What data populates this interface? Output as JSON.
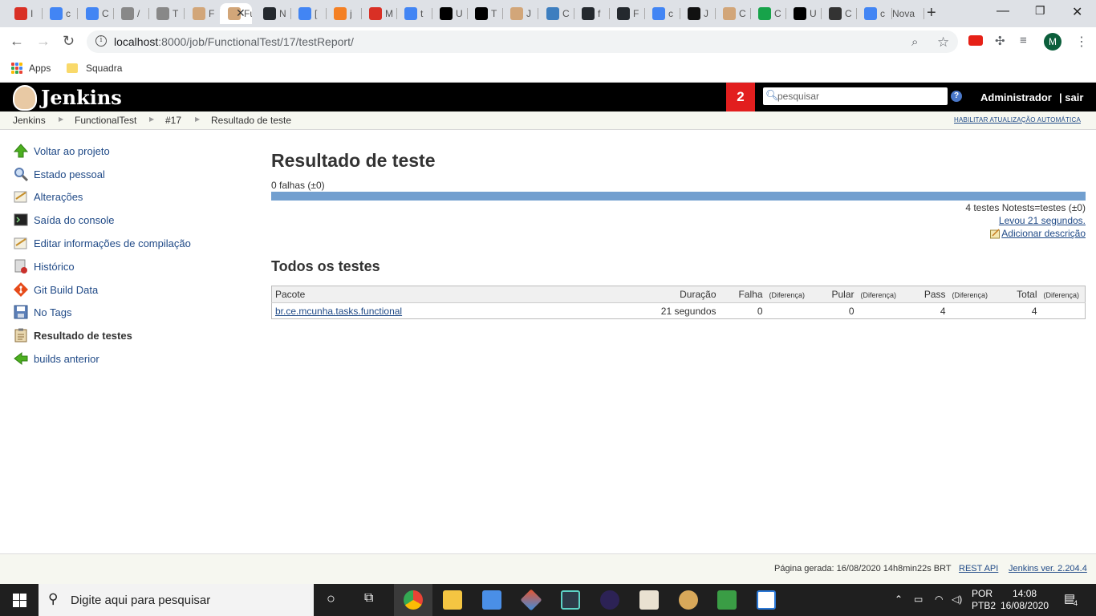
{
  "browser": {
    "tabs": [
      {
        "icon": "tab-favicon-u",
        "label": "I",
        "color": "#d93025"
      },
      {
        "icon": "google-icon",
        "label": "c",
        "color": "#4285f4"
      },
      {
        "icon": "google-translate-icon",
        "label": "C",
        "color": "#4285f4"
      },
      {
        "icon": "image-icon",
        "label": "/",
        "color": "#888888"
      },
      {
        "icon": "image-icon",
        "label": "T",
        "color": "#888888"
      },
      {
        "icon": "jenkins-icon",
        "label": "F",
        "color": "#d2a679"
      },
      {
        "icon": "jenkins-icon",
        "label": "Fu",
        "color": "#d2a679",
        "active": true
      },
      {
        "icon": "github-icon",
        "label": "N",
        "color": "#24292e"
      },
      {
        "icon": "google-icon",
        "label": "[",
        "color": "#4285f4"
      },
      {
        "icon": "stackoverflow-icon",
        "label": "j",
        "color": "#f48024"
      },
      {
        "icon": "pen-icon",
        "label": "M",
        "color": "#d93025"
      },
      {
        "icon": "google-icon",
        "label": "t",
        "color": "#4285f4"
      },
      {
        "icon": "medium-icon",
        "label": "U",
        "color": "#000000"
      },
      {
        "icon": "medium-icon",
        "label": "T",
        "color": "#000000"
      },
      {
        "icon": "jenkins-icon",
        "label": "J",
        "color": "#d2a679"
      },
      {
        "icon": "cube-icon",
        "label": "C",
        "color": "#3d7ebf"
      },
      {
        "icon": "github-icon",
        "label": "f",
        "color": "#24292e"
      },
      {
        "icon": "github-icon",
        "label": "F",
        "color": "#24292e"
      },
      {
        "icon": "google-icon",
        "label": "c",
        "color": "#4285f4"
      },
      {
        "icon": "circle-icon",
        "label": "J",
        "color": "#111111"
      },
      {
        "icon": "jenkins-icon",
        "label": "C",
        "color": "#d2a679"
      },
      {
        "icon": "gitkraken-icon",
        "label": "C",
        "color": "#17a34a"
      },
      {
        "icon": "medium-icon",
        "label": "U",
        "color": "#000000"
      },
      {
        "icon": "link-icon",
        "label": "C",
        "color": "#333333"
      },
      {
        "icon": "google-icon",
        "label": "c",
        "color": "#4285f4"
      },
      {
        "icon": "none",
        "label": "Nova",
        "color": "transparent"
      }
    ],
    "url_host": "localhost",
    "url_rest": ":8000/job/FunctionalTest/17/testReport/",
    "profile_initial": "M",
    "bookmarks": [
      {
        "label": "Apps"
      },
      {
        "label": "Squadra"
      }
    ]
  },
  "jenkins": {
    "title": "Jenkins",
    "notification_count": "2",
    "search_placeholder": "pesquisar",
    "help": "?",
    "user": "Administrador",
    "logout": "| sair",
    "breadcrumbs": [
      "Jenkins",
      "FunctionalTest",
      "#17",
      "Resultado de teste"
    ],
    "auto_refresh": "HABILITAR ATUALIZAÇÃO AUTOMÁTICA",
    "side_panel": [
      {
        "label": "Voltar ao projeto",
        "icon": "up-arrow-icon"
      },
      {
        "label": "Estado pessoal",
        "icon": "search-icon"
      },
      {
        "label": "Alterações",
        "icon": "notepad-icon"
      },
      {
        "label": "Saída do console",
        "icon": "terminal-icon"
      },
      {
        "label": "Editar informações de compilação",
        "icon": "notepad-icon"
      },
      {
        "label": "Histórico",
        "icon": "history-icon"
      },
      {
        "label": "Git Build Data",
        "icon": "git-icon"
      },
      {
        "label": "No Tags",
        "icon": "save-icon"
      },
      {
        "label": "Resultado de testes",
        "icon": "clipboard-icon"
      },
      {
        "label": "builds anterior",
        "icon": "left-arrow-icon"
      }
    ],
    "main": {
      "title": "Resultado de teste",
      "failures": "0 falhas (±0)",
      "pass_ratio": 1.0,
      "summary": "4 testes Notests=testes (±0)",
      "duration_link": "Levou 21 segundos.",
      "add_description": "Adicionar descrição",
      "section_title": "Todos os testes",
      "table": {
        "headers": {
          "package": "Pacote",
          "duration": "Duração",
          "fail": "Falha",
          "skip": "Pular",
          "pass": "Pass",
          "total": "Total",
          "diff": "(Diferença)"
        },
        "rows": [
          {
            "package": "br.ce.mcunha.tasks.functional",
            "duration": "21 segundos",
            "fail": "0",
            "fail_diff": "",
            "skip": "0",
            "skip_diff": "",
            "pass": "4",
            "pass_diff": "",
            "total": "4",
            "total_diff": ""
          }
        ]
      }
    },
    "footer": {
      "generated": "Página gerada: 16/08/2020 14h8min22s BRT",
      "rest_api": "REST API",
      "version": "Jenkins ver. 2.204.4"
    }
  },
  "taskbar": {
    "search_placeholder": "Digite aqui para pesquisar",
    "language": "POR",
    "layout": "PTB2",
    "time": "14:08",
    "date": "16/08/2020",
    "notifications": "4"
  },
  "colors": {
    "jenkins_header": "#000000",
    "badge": "#e21e1e",
    "link": "#204a87",
    "progress_pass": "#729fcf"
  }
}
